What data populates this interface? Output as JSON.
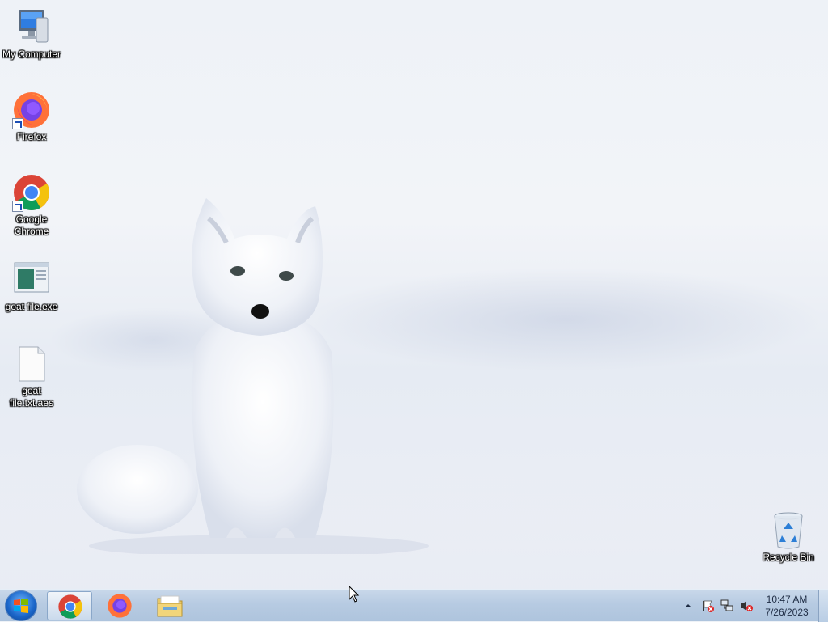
{
  "desktop": {
    "icons": [
      {
        "label": "My Computer",
        "icon": "computer-icon",
        "shortcut": false
      },
      {
        "label": "Firefox",
        "icon": "firefox-icon",
        "shortcut": true
      },
      {
        "label": "Google Chrome",
        "icon": "chrome-icon",
        "shortcut": true
      },
      {
        "label": "goat file.exe",
        "icon": "executable-icon",
        "shortcut": false
      },
      {
        "label": "goat file.txt.aes",
        "icon": "file-icon",
        "shortcut": false
      },
      {
        "label": "Recycle Bin",
        "icon": "recycle-bin-icon",
        "shortcut": false
      }
    ],
    "wallpaper": "arctic fox in snow"
  },
  "taskbar": {
    "start_icon": "windows-logo-icon",
    "pinned": [
      {
        "name": "Google Chrome",
        "icon": "chrome-icon",
        "active": true
      },
      {
        "name": "Firefox",
        "icon": "firefox-icon",
        "active": false
      },
      {
        "name": "Windows Explorer",
        "icon": "folder-icon",
        "active": false
      }
    ],
    "tray": {
      "icons": [
        "show-hidden-icons-icon",
        "action-center-flag-icon",
        "network-icon",
        "volume-muted-icon"
      ],
      "time": "10:47 AM",
      "date": "7/26/2023"
    }
  },
  "colors": {
    "taskbar": "#b7cbe2",
    "chrome_red": "#db4437",
    "chrome_yellow": "#f4c20d",
    "chrome_green": "#0f9d58",
    "chrome_blue": "#4285f4",
    "firefox_orange": "#ff7139"
  }
}
